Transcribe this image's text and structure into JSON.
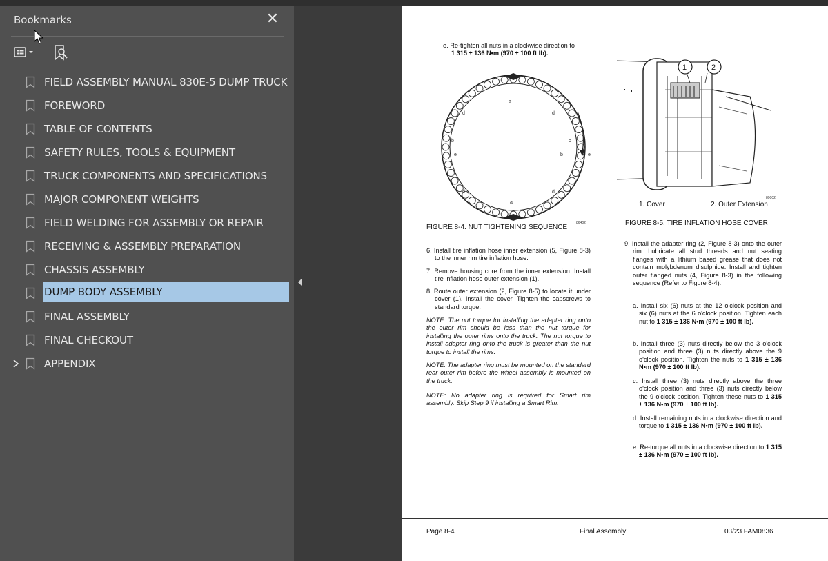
{
  "sidebar": {
    "title": "Bookmarks",
    "close_symbol": "✕",
    "bookmarks": [
      {
        "label": "FIELD ASSEMBLY MANUAL 830E-5  DUMP TRUCK"
      },
      {
        "label": "FOREWORD"
      },
      {
        "label": "TABLE OF CONTENTS"
      },
      {
        "label": "SAFETY RULES, TOOLS & EQUIPMENT"
      },
      {
        "label": "TRUCK COMPONENTS AND SPECIFICATIONS"
      },
      {
        "label": "MAJOR COMPONENT WEIGHTS"
      },
      {
        "label": "FIELD WELDING FOR ASSEMBLY OR REPAIR"
      },
      {
        "label": "RECEIVING & ASSEMBLY PREPARATION"
      },
      {
        "label": "CHASSIS ASSEMBLY"
      },
      {
        "label": "DUMP BODY ASSEMBLY"
      },
      {
        "label": "FINAL ASSEMBLY"
      },
      {
        "label": "FINAL CHECKOUT"
      },
      {
        "label": "APPENDIX"
      }
    ],
    "selected_index": 9,
    "expandable_index": 12
  },
  "page": {
    "left_col": {
      "step_e_top": "e. Re-tighten all nuts in a clockwise direction to",
      "step_e_top_bold": "1 315 ± 136 N•m (970 ± 100 ft lb).",
      "fig4_caption": "FIGURE 8-4. NUT TIGHTENING SEQUENCE",
      "fig4_code": "86402",
      "fig4_letters": [
        "a",
        "b",
        "c",
        "d",
        "e"
      ],
      "step6": "6. Install tire inflation hose inner extension (5, Figure 8-3) to the inner rim tire inflation hose.",
      "step7": "7. Remove housing core from the inner extension. Install tire inflation hose outer extension (1).",
      "step8": "8. Route outer extension (2, Figure 8-5) to locate it under cover (1). Install the cover. Tighten the capscrews to standard torque.",
      "note1": "NOTE: The nut torque for installing the adapter ring onto the outer rim should be less than the nut torque for installing the outer rims onto the truck. The nut torque to install adapter ring onto the truck is greater than the nut torque to install the rims.",
      "note2": "NOTE: The adapter ring must be mounted on the standard rear outer rim before the wheel assembly is mounted on the truck.",
      "note3": "NOTE: No adapter ring is required for Smart rim assembly. Skip Step 9 if installing a Smart Rim."
    },
    "right_col": {
      "callout_1": "1",
      "callout_2": "2",
      "fig5_code": "89002",
      "legend_1": "1. Cover",
      "legend_2": "2. Outer Extension",
      "fig5_caption": "FIGURE 8-5. TIRE INFLATION HOSE COVER",
      "step9": "9. Install the adapter ring (2, Figure 8-3) onto the outer rim. Lubricate all stud threads and nut seating flanges with a lithium based grease that does not contain molybdenum disulphide. Install and tighten outer flanged nuts (4, Figure 8-3) in the following sequence (Refer to Figure 8-4).",
      "sub_a": "a. Install six (6) nuts at the 12 o'clock position and six (6) nuts at the 6 o'clock position. Tighten each nut to",
      "sub_a_bold": "1 315 ± 136 N•m (970 ± 100 ft lb).",
      "sub_b": "b. Install three (3) nuts directly below the 3 o'clock position and three (3) nuts directly above the 9 o'clock position. Tighten the nuts to",
      "sub_b_bold": "1 315 ± 136 N•m (970 ± 100 ft lb).",
      "sub_c": "c. Install three (3) nuts directly above the three o'clock position and three (3) nuts directly below the 9 o'clock position. Tighten these nuts to",
      "sub_c_bold": "1 315 ± 136 N•m (970 ± 100 ft lb).",
      "sub_d": "d. Install remaining nuts in a clockwise direction and torque to",
      "sub_d_bold": "1 315 ± 136 N•m (970 ± 100 ft lb).",
      "sub_e": "e. Re-torque all nuts in a clockwise direction to",
      "sub_e_bold": "1 315 ± 136 N•m (970 ± 100 ft lb)."
    },
    "footer": {
      "left": "Page 8-4",
      "center": "Final Assembly",
      "right": "03/23  FAM0836"
    }
  },
  "colors": {
    "sidebar_bg": "#505050",
    "viewer_bg": "#3b3b3b",
    "selection": "#a6c8e6"
  }
}
